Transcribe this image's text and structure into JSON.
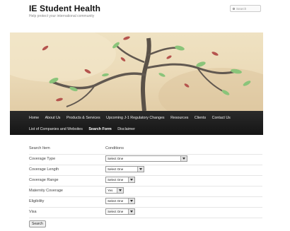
{
  "site": {
    "title": "IE Student Health",
    "description": "Help protect your international community",
    "search_placeholder": "Search"
  },
  "nav": {
    "row1": [
      "Home",
      "About Us",
      "Products & Services",
      "Upcoming J-1 Regulatory Changes",
      "Resources",
      "Clients",
      "Contact Us"
    ],
    "row2": [
      "List of Companies and Websites",
      "Search Form",
      "Disclaimer"
    ],
    "active": "Search Form"
  },
  "form": {
    "header": {
      "label": "Search Item",
      "value": "Conditions"
    },
    "rows": [
      {
        "label": "Coverage Type",
        "selected": "Select One"
      },
      {
        "label": "Coverage Length",
        "selected": "Select One"
      },
      {
        "label": "Coverage Range",
        "selected": "Select One"
      },
      {
        "label": "Maternity Coverage",
        "selected": "Yes"
      },
      {
        "label": "Eligibility",
        "selected": "Select One"
      },
      {
        "label": "Visa",
        "selected": "Select One"
      }
    ],
    "submit_label": "Search"
  },
  "colors": {
    "nav_bg": "#1c1c1c",
    "banner_bg": "#ecdcba",
    "leaf_green": "#7ab86a",
    "leaf_red": "#b04a48"
  }
}
